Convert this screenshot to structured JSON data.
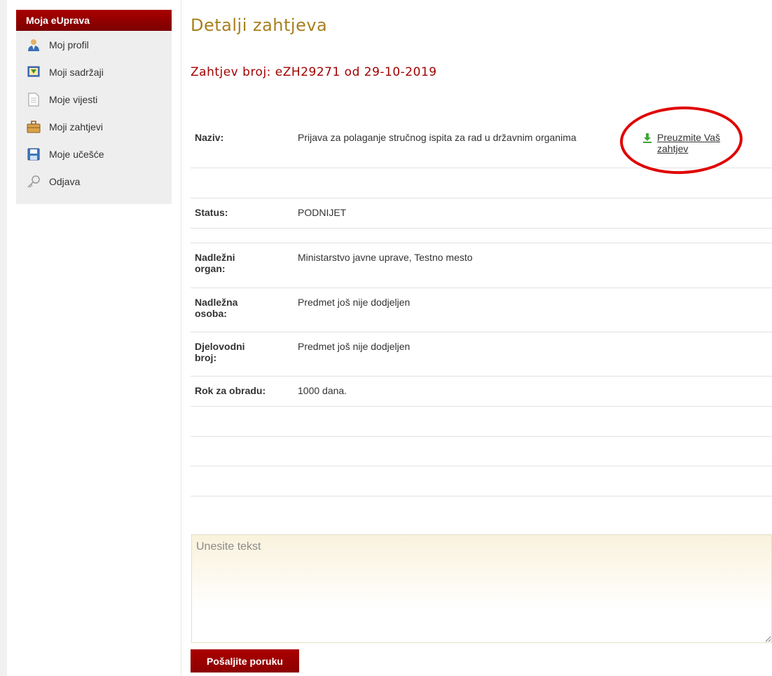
{
  "sidebar": {
    "header": "Moja eUprava",
    "items": [
      {
        "label": "Moj profil",
        "icon": "user-profile-icon"
      },
      {
        "label": "Moji sadržaji",
        "icon": "content-monitor-icon"
      },
      {
        "label": "Moje vijesti",
        "icon": "document-icon"
      },
      {
        "label": "Moji zahtjevi",
        "icon": "briefcase-icon"
      },
      {
        "label": "Moje učešće",
        "icon": "floppy-disk-icon"
      },
      {
        "label": "Odjava",
        "icon": "key-icon"
      }
    ]
  },
  "main": {
    "title": "Detalji zahtjeva",
    "request_number": "Zahtjev broj: eZH29271 od 29-10-2019",
    "download_label": "Preuzmite Vaš zahtjev",
    "rows": {
      "naziv": {
        "label": "Naziv:",
        "value": "Prijava za polaganje stručnog ispita za rad u državnim organima"
      },
      "status": {
        "label": "Status:",
        "value": "PODNIJET"
      },
      "organ": {
        "label": "Nadležni organ:",
        "value": "Ministarstvo javne uprave, Testno mesto"
      },
      "osoba": {
        "label": "Nadležna osoba:",
        "value": "Predmet još nije dodjeljen"
      },
      "broj": {
        "label": "Djelovodni broj:",
        "value": "Predmet još nije dodjeljen"
      },
      "rok": {
        "label": "Rok za obradu:",
        "value": "1000 dana."
      }
    },
    "message_placeholder": "Unesite tekst",
    "send_button": "Pošaljite poruku"
  },
  "colors": {
    "brand_red": "#990000",
    "title_gold": "#a8801e",
    "annotation_red": "#e00000"
  }
}
